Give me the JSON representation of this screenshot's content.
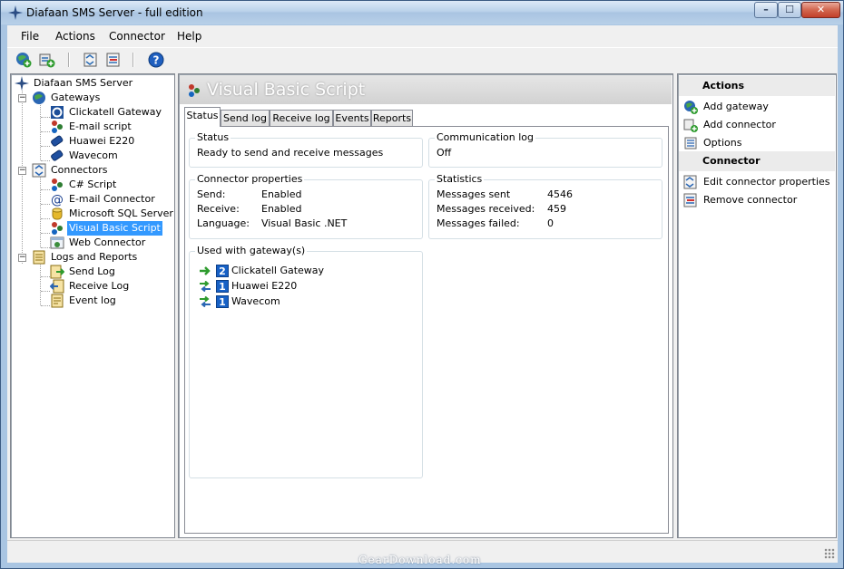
{
  "window": {
    "title": "Diafaan SMS Server - full edition",
    "controls": {
      "minimize": "–",
      "maximize": "☐",
      "close": "✕"
    }
  },
  "menu": [
    "File",
    "Actions",
    "Connector",
    "Help"
  ],
  "toolbar": {
    "buttons": [
      "add-gateway-icon",
      "add-connector-icon",
      "edit-properties-icon",
      "remove-icon",
      "help-icon"
    ],
    "help_glyph": "?"
  },
  "tree": {
    "root": "Diafaan SMS Server",
    "gateways": {
      "label": "Gateways",
      "items": [
        "Clickatell Gateway",
        "E-mail script",
        "Huawei E220",
        "Wavecom"
      ]
    },
    "connectors": {
      "label": "Connectors",
      "items": [
        "C# Script",
        "E-mail Connector",
        "Microsoft SQL Server",
        "Visual Basic Script",
        "Web Connector"
      ],
      "selected": "Visual Basic Script"
    },
    "logs": {
      "label": "Logs and Reports",
      "items": [
        "Send Log",
        "Receive Log",
        "Event log"
      ]
    },
    "expander_minus": "−"
  },
  "main": {
    "header_title": "Visual Basic Script",
    "tabs": [
      "Status",
      "Send log",
      "Receive log",
      "Events",
      "Reports"
    ],
    "active_tab": "Status",
    "status": {
      "title": "Status",
      "value": "Ready to send and receive messages"
    },
    "comm_log": {
      "title": "Communication log",
      "value": "Off"
    },
    "connector_properties": {
      "title": "Connector properties",
      "rows": [
        {
          "key": "Send:",
          "value": "Enabled"
        },
        {
          "key": "Receive:",
          "value": "Enabled"
        },
        {
          "key": "Language:",
          "value": "Visual Basic .NET"
        }
      ]
    },
    "statistics": {
      "title": "Statistics",
      "rows": [
        {
          "key": "Messages sent",
          "value": "4546"
        },
        {
          "key": "Messages received:",
          "value": "459"
        },
        {
          "key": "Messages failed:",
          "value": "0"
        }
      ]
    },
    "used_with": {
      "title": "Used with gateway(s)",
      "gateways": [
        {
          "priority": "2",
          "name": "Clickatell Gateway",
          "direction": "send"
        },
        {
          "priority": "1",
          "name": "Huawei E220",
          "direction": "both"
        },
        {
          "priority": "1",
          "name": "Wavecom",
          "direction": "both"
        }
      ]
    }
  },
  "actions_panel": {
    "actions_title": "Actions",
    "actions": [
      "Add gateway",
      "Add connector",
      "Options"
    ],
    "connector_title": "Connector",
    "connector_actions": [
      "Edit connector properties",
      "Remove connector"
    ]
  },
  "watermark": "GearDownload.com",
  "colors": {
    "title_bar": "#b9d1ea",
    "selection": "#3399ff",
    "priority_badge": "#1761c6",
    "panel_header": "#ebebeb"
  }
}
